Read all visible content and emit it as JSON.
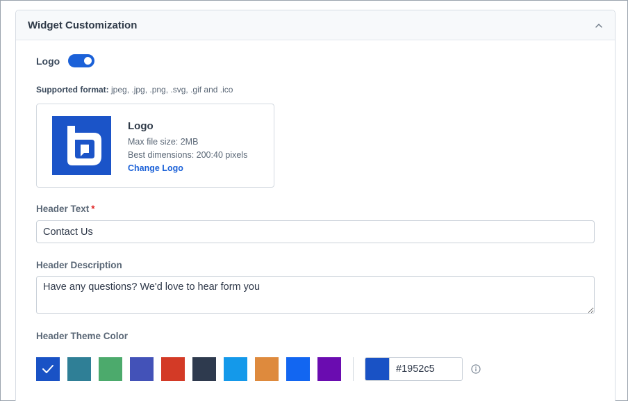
{
  "panel": {
    "title": "Widget Customization",
    "collapse_icon": "chevron-up-icon"
  },
  "logo": {
    "label": "Logo",
    "toggle_on": true,
    "formats_label": "Supported format:",
    "formats_value": " jpeg, .jpg, .png, .svg, .gif and .ico",
    "upload": {
      "title": "Logo",
      "max_size": "Max file size: 2MB",
      "dimensions": "Best dimensions: 200:40 pixels",
      "change_label": "Change Logo"
    }
  },
  "header_text": {
    "label": "Header Text",
    "required_mark": "*",
    "value": "Contact Us"
  },
  "header_description": {
    "label": "Header Description",
    "value": "Have any questions? We'd love to hear form you"
  },
  "theme_color": {
    "label": "Header Theme Color",
    "swatches": [
      "#1952c5",
      "#2f7f96",
      "#4caa6c",
      "#4352b8",
      "#d33a26",
      "#2e3a4e",
      "#1499ea",
      "#de8a3d",
      "#1266f1",
      "#6a0cb0"
    ],
    "selected_index": 0,
    "selected_hex": "#1952c5",
    "info_icon": "info-icon"
  }
}
